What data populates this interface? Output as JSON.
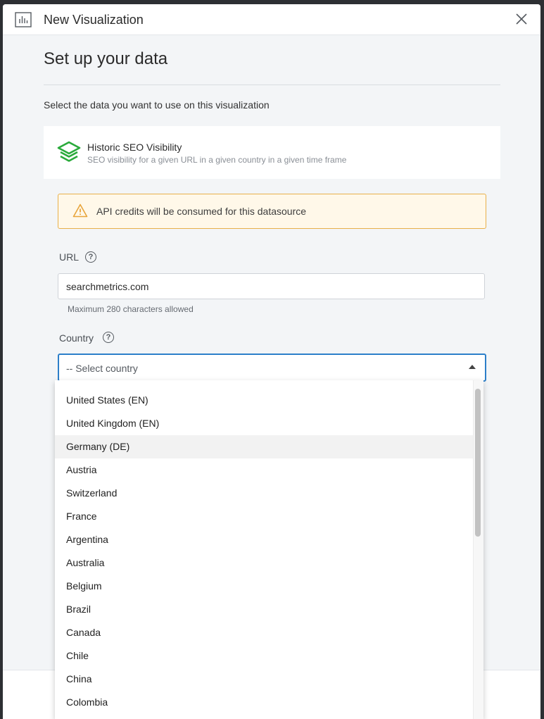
{
  "header": {
    "title": "New Visualization"
  },
  "page": {
    "title": "Set up your data",
    "intro": "Select the data you want to use on this visualization"
  },
  "datasource": {
    "name": "Historic SEO Visibility",
    "description": "SEO visibility for a given URL in a given country in a given time frame",
    "icon": "layers-icon",
    "icon_color": "#2aaa3b"
  },
  "warning": {
    "text": "API credits will be consumed for this datasource",
    "icon": "warning-icon",
    "color": "#e8b04a"
  },
  "url_field": {
    "label": "URL",
    "value": "searchmetrics.com",
    "hint": "Maximum 280 characters allowed"
  },
  "country_field": {
    "label": "Country",
    "placeholder": "-- Select country",
    "accent": "#2c7fc9",
    "options": [
      "United States (EN)",
      "United Kingdom (EN)",
      "Germany (DE)",
      "Austria",
      "Switzerland",
      "France",
      "Argentina",
      "Australia",
      "Belgium",
      "Brazil",
      "Canada",
      "Chile",
      "China",
      "Colombia"
    ],
    "hovered_option": "Germany (DE)"
  }
}
